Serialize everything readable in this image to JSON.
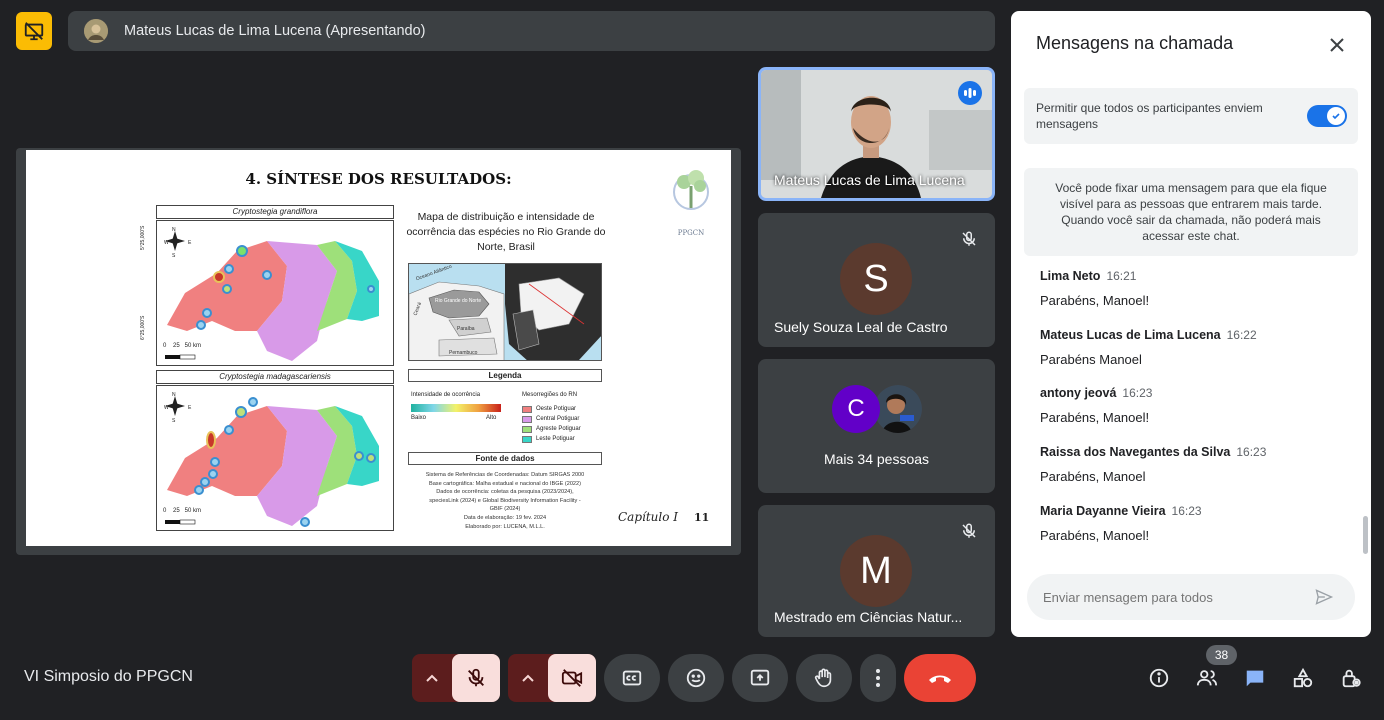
{
  "presenter": {
    "name": "Mateus Lucas de Lima Lucena (Apresentando)"
  },
  "slide": {
    "title": "4. SÍNTESE DOS RESULTADOS:",
    "map_title": "Mapa de distribuição e intensidade de ocorrência das espécies no Rio Grande do Norte, Brasil",
    "species1": "Cryptostegia grandiflora",
    "species2": "Cryptostegia madagascariensis",
    "legend_title": "Legenda",
    "intensity_label": "Intensidade de ocorrência",
    "low": "Baixo",
    "high": "Alto",
    "meso_title": "Mesorregiões do RN",
    "meso": [
      "Oeste Potiguar",
      "Central Potiguar",
      "Agreste Potiguar",
      "Leste Potiguar"
    ],
    "meso_colors": [
      "#f08080",
      "#d89ae8",
      "#9ee07a",
      "#38d6c8"
    ],
    "sources_title": "Fonte de dados",
    "sources_lines": [
      "Sistema de Referências de Coordenadas: Datum SIRGAS 2000",
      "Base cartográfica: Malha estadual e nacional do IBGE (2022)",
      "Dados de ocorrência: coletas da pesquisa (2023/2024),",
      "speciesLink (2024) e Global Biodiversity Information Facility -",
      "GBIF (2024)",
      "Data de elaboração: 19 fev. 2024",
      "Elaborado por: LUCENA, M.L.L."
    ],
    "scale": "0    25   50 km",
    "lat1": "5°25,000'S",
    "lat2": "6°25,000'S",
    "chapter": "Capítulo I",
    "page": "11",
    "logo": "PPGCN",
    "inset_ocean": "Oceano Atlântico",
    "inset_rn": "Rio Grande do Norte",
    "inset_pb": "Paraíba",
    "inset_pe": "Pernambuco",
    "inset_ceara": "Ceará"
  },
  "tiles": {
    "t1": {
      "name": "Mateus Lucas de Lima Lucena"
    },
    "t2": {
      "name": "Suely Souza Leal de Castro",
      "initial": "S"
    },
    "t3": {
      "name": "Mais 34 pessoas",
      "initial": "C"
    },
    "t4": {
      "name": "Mestrado em Ciências Natur...",
      "initial": "M"
    }
  },
  "panel": {
    "title": "Mensagens na chamada",
    "toggle_label": "Permitir que todos os participantes enviem mensagens",
    "toggle_on": true,
    "info": "Você pode fixar uma mensagem para que ela fique visível para as pessoas que entrarem mais tarde. Quando você sair da chamada, não poderá mais acessar este chat.",
    "messages": [
      {
        "sender": "Lima Neto",
        "time": "16:21",
        "text": "Parabéns, Manoel!"
      },
      {
        "sender": "Mateus Lucas de Lima Lucena",
        "time": "16:22",
        "text": "Parabéns Manoel"
      },
      {
        "sender": "antony jeová",
        "time": "16:23",
        "text": "Parabéns, Manoel!"
      },
      {
        "sender": "Raissa dos Navegantes da Silva",
        "time": "16:23",
        "text": "Parabéns, Manoel"
      },
      {
        "sender": "Maria Dayanne Vieira",
        "time": "16:23",
        "text": "Parabéns, Manoel!"
      }
    ],
    "input_placeholder": "Enviar mensagem para todos"
  },
  "bottom": {
    "meeting_name": "VI Simposio do PPGCN",
    "people_count": "38"
  },
  "colors": {
    "accent": "#1a73e8",
    "danger": "#ea4335",
    "presenting": "#fbbc04",
    "active_tile": "#8ab4f8"
  }
}
